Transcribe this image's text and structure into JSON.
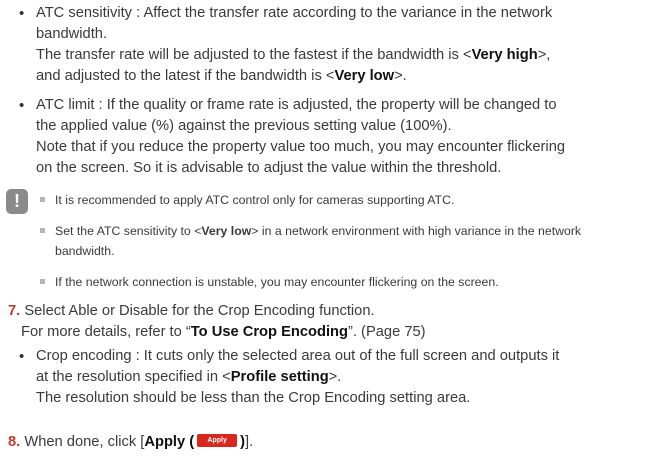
{
  "atc_sensitivity": {
    "line1": "ATC sensitivity : Affect the transfer rate according to the variance in the network",
    "line2": "bandwidth.",
    "line3_a": "The transfer rate will be adjusted to the fastest if the bandwidth is <",
    "line3_b": "Very high",
    "line3_c": ">,",
    "line4_a": "and adjusted to the latest if the bandwidth is <",
    "line4_b": "Very low",
    "line4_c": ">."
  },
  "atc_limit": {
    "line1": "ATC limit : If the quality or frame rate is adjusted, the property will be changed to",
    "line2": "the applied value (%) against the previous setting value (100%).",
    "line3": "Note that if you reduce the property value too much, you may encounter flickering",
    "line4": "on the screen. So it is advisable to adjust the value within the threshold."
  },
  "note": {
    "icon": "!",
    "item1": "It is recommended to apply ATC control only for cameras supporting ATC.",
    "item2_a": "Set the ATC sensitivity to <",
    "item2_b": "Very low",
    "item2_c": "> in a network environment with high variance in the network",
    "item2_line2": "bandwidth.",
    "item3": "If the network connection is unstable, you may encounter flickering on the screen."
  },
  "step7": {
    "number": "7.",
    "line1": "Select Able or Disable for the Crop Encoding function.",
    "line2_a": "For more details, refer to “",
    "line2_b": "To Use Crop Encoding",
    "line2_c": "”. (Page 75)",
    "bullet_line1": "Crop encoding : It cuts only the selected area out of the full screen and outputs it",
    "bullet_line2_a": "at the resolution specified in <",
    "bullet_line2_b": "Profile setting",
    "bullet_line2_c": ">.",
    "bullet_line3": "The resolution should be less than the Crop Encoding setting area."
  },
  "step8": {
    "number": "8.",
    "text_a": "When done, click [",
    "text_b": "Apply (",
    "button_label": "Apply",
    "text_c": ")",
    "text_d": "]."
  }
}
